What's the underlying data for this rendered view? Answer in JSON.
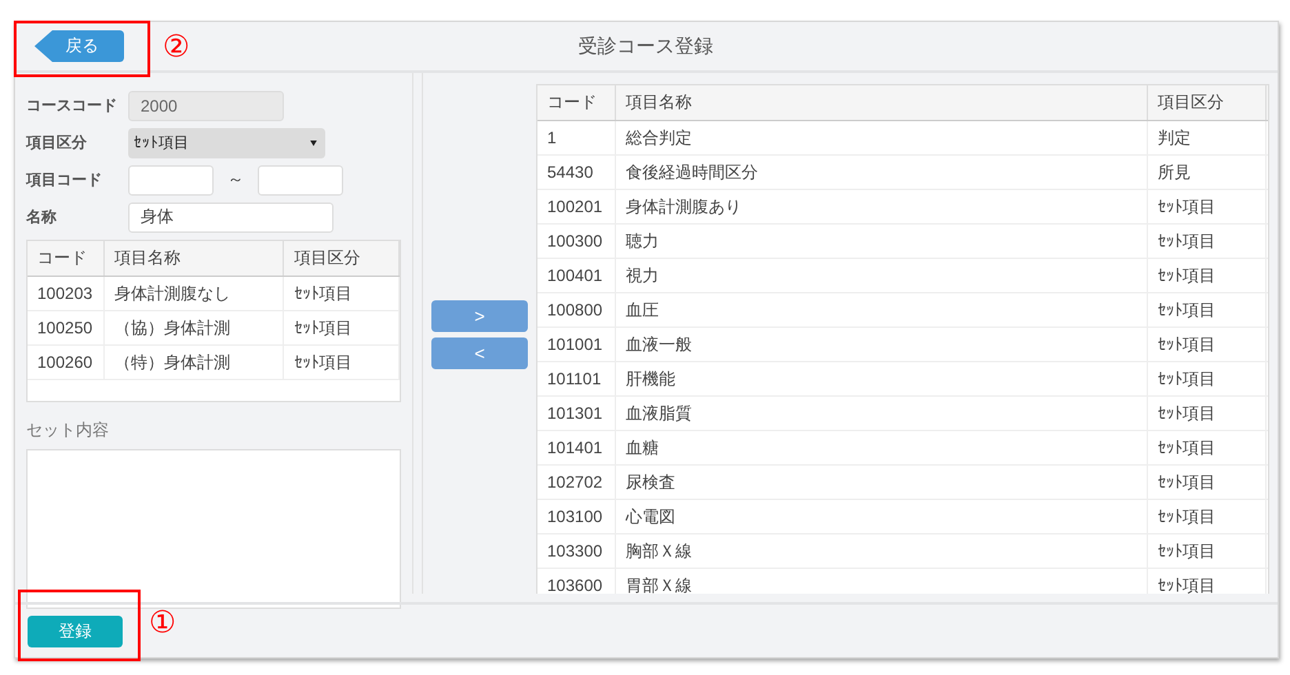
{
  "header": {
    "back_button": "戻る",
    "title": "受診コース登録"
  },
  "form": {
    "fields": [
      {
        "kind": "text",
        "label": "コースコード",
        "value": "2000",
        "disabled": true
      },
      {
        "kind": "select",
        "label": "項目区分",
        "value": "ｾｯﾄ項目"
      },
      {
        "kind": "range",
        "label": "項目コード",
        "separator": "～"
      },
      {
        "kind": "text",
        "label": "名称",
        "value": "身体",
        "disabled": false
      }
    ]
  },
  "search_table": {
    "columns": [
      "コード",
      "項目名称",
      "項目区分"
    ],
    "rows": [
      [
        "100203",
        "身体計測腹なし",
        "ｾｯﾄ項目"
      ],
      [
        "100250",
        "（協）身体計測",
        "ｾｯﾄ項目"
      ],
      [
        "100260",
        "（特）身体計測",
        "ｾｯﾄ項目"
      ]
    ]
  },
  "set_contents": {
    "label": "セット内容"
  },
  "move_buttons": [
    ">",
    "<"
  ],
  "selected_table": {
    "columns": [
      "コード",
      "項目名称",
      "項目区分"
    ],
    "rows": [
      [
        "1",
        "総合判定",
        "判定"
      ],
      [
        "54430",
        "食後経過時間区分",
        "所見"
      ],
      [
        "100201",
        "身体計測腹あり",
        "ｾｯﾄ項目"
      ],
      [
        "100300",
        "聴力",
        "ｾｯﾄ項目"
      ],
      [
        "100401",
        "視力",
        "ｾｯﾄ項目"
      ],
      [
        "100800",
        "血圧",
        "ｾｯﾄ項目"
      ],
      [
        "101001",
        "血液一般",
        "ｾｯﾄ項目"
      ],
      [
        "101101",
        "肝機能",
        "ｾｯﾄ項目"
      ],
      [
        "101301",
        "血液脂質",
        "ｾｯﾄ項目"
      ],
      [
        "101401",
        "血糖",
        "ｾｯﾄ項目"
      ],
      [
        "102702",
        "尿検査",
        "ｾｯﾄ項目"
      ],
      [
        "103100",
        "心電図",
        "ｾｯﾄ項目"
      ],
      [
        "103300",
        "胸部Ｘ線",
        "ｾｯﾄ項目"
      ],
      [
        "103600",
        "胃部Ｘ線",
        "ｾｯﾄ項目"
      ]
    ]
  },
  "footer": {
    "register_button": "登録"
  },
  "annotations": [
    {
      "label": "②"
    },
    {
      "label": "①"
    }
  ]
}
